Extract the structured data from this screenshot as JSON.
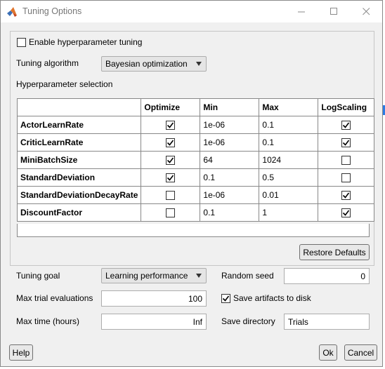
{
  "window": {
    "title": "Tuning Options",
    "controls": [
      "minimize",
      "maximize",
      "close"
    ]
  },
  "enable_tuning": {
    "label": "Enable hyperparameter tuning",
    "checked": false
  },
  "algorithm": {
    "label": "Tuning algorithm",
    "value": "Bayesian optimization"
  },
  "hyperparam_section_label": "Hyperparameter selection",
  "table": {
    "headers": [
      "",
      "Optimize",
      "Min",
      "Max",
      "LogScaling"
    ],
    "rows": [
      {
        "name": "ActorLearnRate",
        "optimize": true,
        "min": "1e-06",
        "max": "0.1",
        "log": true
      },
      {
        "name": "CriticLearnRate",
        "optimize": true,
        "min": "1e-06",
        "max": "0.1",
        "log": true
      },
      {
        "name": "MiniBatchSize",
        "optimize": true,
        "min": "64",
        "max": "1024",
        "log": false
      },
      {
        "name": "StandardDeviation",
        "optimize": true,
        "min": "0.1",
        "max": "0.5",
        "log": false
      },
      {
        "name": "StandardDeviationDecayRate",
        "optimize": false,
        "min": "1e-06",
        "max": "0.01",
        "log": true
      },
      {
        "name": "DiscountFactor",
        "optimize": false,
        "min": "0.1",
        "max": "1",
        "log": true
      }
    ]
  },
  "restore_defaults_label": "Restore Defaults",
  "goal": {
    "label": "Tuning goal",
    "value": "Learning performance"
  },
  "seed": {
    "label": "Random seed",
    "value": "0"
  },
  "max_trials": {
    "label": "Max trial evaluations",
    "value": "100"
  },
  "save_artifacts": {
    "label": "Save artifacts to disk",
    "checked": true
  },
  "max_time": {
    "label": "Max time (hours)",
    "value": "Inf"
  },
  "save_dir": {
    "label": "Save directory",
    "value": "Trials"
  },
  "buttons": {
    "help": "Help",
    "ok": "Ok",
    "cancel": "Cancel"
  }
}
